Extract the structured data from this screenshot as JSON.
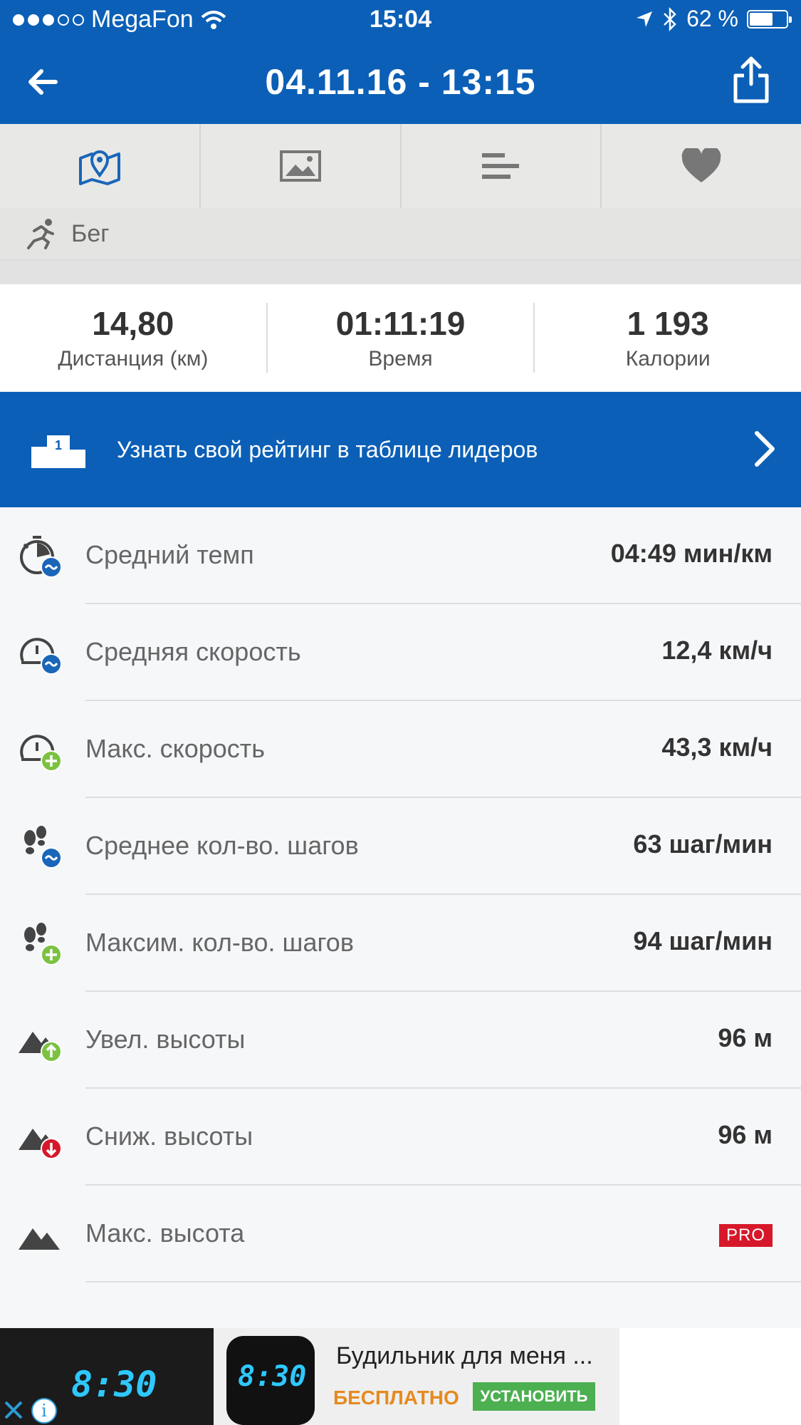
{
  "status_bar": {
    "carrier": "MegaFon",
    "time": "15:04",
    "battery": "62 %",
    "signal_bars_filled": 3,
    "signal_bars_total": 5
  },
  "header": {
    "title": "04.11.16 - 13:15",
    "back_icon": "back-arrow-icon",
    "share_icon": "share-icon"
  },
  "tabs": [
    {
      "icon": "map-pin-icon",
      "active": true
    },
    {
      "icon": "photo-icon",
      "active": false
    },
    {
      "icon": "bar-list-icon",
      "active": false
    },
    {
      "icon": "heart-icon",
      "active": false
    }
  ],
  "sport": {
    "label": "Бег",
    "icon": "running-icon"
  },
  "summary": [
    {
      "value": "14,80",
      "label": "Дистанция (км)"
    },
    {
      "value": "01:11:19",
      "label": "Время"
    },
    {
      "value": "1 193",
      "label": "Калории"
    }
  ],
  "leaderboard_banner": {
    "text": "Узнать свой рейтинг в таблице лидеров",
    "rank_digit": "1"
  },
  "stats": [
    {
      "label": "Средний темп",
      "value": "04:49 мин/км",
      "icon": "stopwatch-avg-icon"
    },
    {
      "label": "Средняя скорость",
      "value": "12,4 км/ч",
      "icon": "speedometer-avg-icon"
    },
    {
      "label": "Макс. скорость",
      "value": "43,3 км/ч",
      "icon": "speedometer-max-icon"
    },
    {
      "label": "Среднее кол-во. шагов",
      "value": "63 шаг/мин",
      "icon": "footsteps-avg-icon"
    },
    {
      "label": "Максим. кол-во. шагов",
      "value": "94 шаг/мин",
      "icon": "footsteps-max-icon"
    },
    {
      "label": "Увел. высоты",
      "value": "96 м",
      "icon": "elevation-gain-icon"
    },
    {
      "label": "Сниж. высоты",
      "value": "96 м",
      "icon": "elevation-loss-icon"
    },
    {
      "label": "Макс. высота",
      "value": "",
      "pro_badge": "PRO",
      "icon": "mountain-icon"
    }
  ],
  "ad": {
    "title": "Будильник для меня ...",
    "price": "БЕСПЛАТНО",
    "install": "УСТАНОВИТЬ",
    "phone_clock": "8:30",
    "icon_clock": "8:30"
  },
  "colors": {
    "brand_blue": "#0b5fb6",
    "pro_red": "#d6182a",
    "green": "#4caf50",
    "orange": "#e68a1f"
  }
}
